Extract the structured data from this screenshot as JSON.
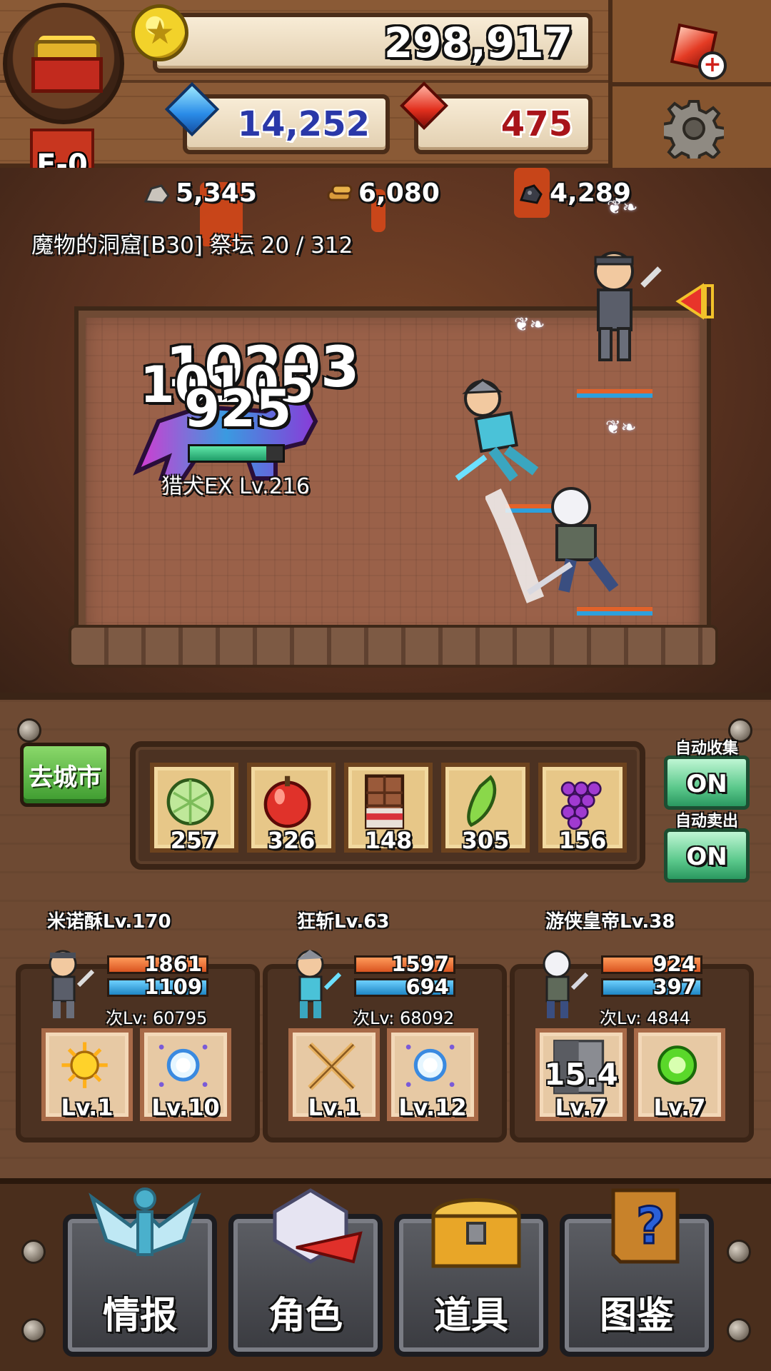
{
  "hud": {
    "rank": "E-0",
    "gold": "298,917",
    "blue_gems": "14,252",
    "red_gems": "475",
    "resources": [
      {
        "icon": "ore-icon",
        "value": "5,345"
      },
      {
        "icon": "wood-icon",
        "value": "6,080"
      },
      {
        "icon": "coal-icon",
        "value": "4,289"
      }
    ],
    "stage": "魔物的洞窟[B30] 祭坛 20 / 312"
  },
  "battle": {
    "damage_numbers": [
      "10203",
      "10105",
      "925"
    ],
    "enemy": {
      "name": "猎犬EX Lv.216",
      "hp_ratio": 0.82
    }
  },
  "panel": {
    "town_button": "去城市",
    "inventory": [
      {
        "icon": "melon-icon",
        "count": "257"
      },
      {
        "icon": "apple-icon",
        "count": "326"
      },
      {
        "icon": "chocolate-icon",
        "count": "148"
      },
      {
        "icon": "pepper-icon",
        "count": "305"
      },
      {
        "icon": "grape-icon",
        "count": "156"
      }
    ],
    "auto_collect": {
      "label": "自动收集",
      "state": "ON"
    },
    "auto_sell": {
      "label": "自动卖出",
      "state": "ON"
    }
  },
  "characters": [
    {
      "name": "米诺酥Lv.170",
      "hp": "1861",
      "mp": "1109",
      "next_lv": "次Lv: 60795",
      "skills": [
        {
          "icon": "sun-burst-icon",
          "level": "Lv.1"
        },
        {
          "icon": "light-orb-icon",
          "level": "Lv.10"
        }
      ]
    },
    {
      "name": "狂斩Lv.63",
      "hp": "1597",
      "mp": "694",
      "next_lv": "次Lv: 68092",
      "skills": [
        {
          "icon": "crossed-swords-icon",
          "level": "Lv.1"
        },
        {
          "icon": "light-orb-icon",
          "level": "Lv.12"
        }
      ]
    },
    {
      "name": "游侠皇帝Lv.38",
      "hp": "924",
      "mp": "397",
      "next_lv": "次Lv: 4844",
      "skills": [
        {
          "icon": "cooldown-skill-icon",
          "level": "Lv.7",
          "cooldown": "15.4"
        },
        {
          "icon": "green-orb-icon",
          "level": "Lv.7"
        }
      ]
    }
  ],
  "nav": [
    {
      "label": "情报",
      "icon": "info-icon"
    },
    {
      "label": "角色",
      "icon": "character-icon"
    },
    {
      "label": "道具",
      "icon": "treasure-chest-icon"
    },
    {
      "label": "图鉴",
      "icon": "encyclopedia-icon"
    }
  ],
  "colors": {
    "hp": "#d95420",
    "mp": "#1f86c4",
    "toggle_on": "#5cc98c",
    "town_button": "#3c9a2e"
  }
}
